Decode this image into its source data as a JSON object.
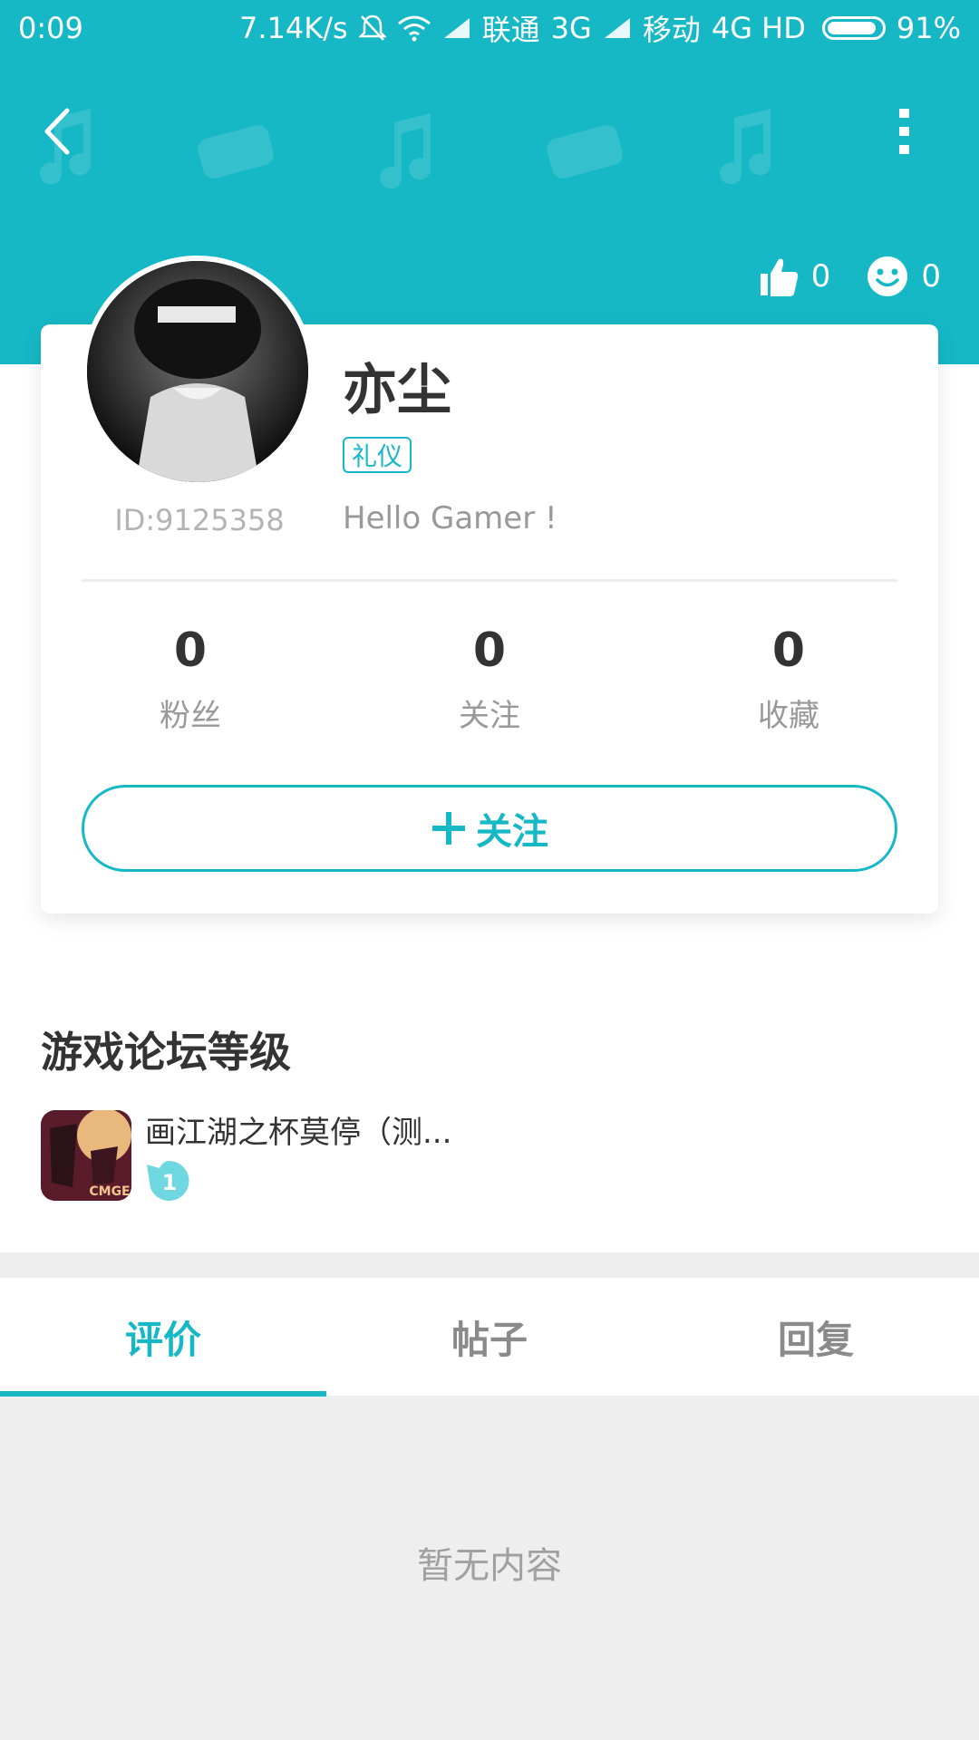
{
  "status_bar": {
    "time": "0:09",
    "net_speed": "7.14K/s",
    "carrier1": "联通",
    "net1": "3G",
    "carrier2": "移动",
    "net2": "4G HD",
    "battery": "91%",
    "battery_level": 0.91
  },
  "header": {
    "back_icon": "chevron-left-icon",
    "more_icon": "more-vertical-icon",
    "likes_count": "0",
    "smiles_count": "0"
  },
  "profile": {
    "username": "亦尘",
    "badge": "礼仪",
    "id_text": "ID:9125358",
    "bio": "Hello Gamer !",
    "stats": [
      {
        "value": "0",
        "label": "粉丝"
      },
      {
        "value": "0",
        "label": "关注"
      },
      {
        "value": "0",
        "label": "收藏"
      }
    ],
    "follow_label": "关注"
  },
  "forum_level": {
    "title": "游戏论坛等级",
    "game_name": "画江湖之杯莫停（测...",
    "icon_text": "CMGE",
    "level": "1"
  },
  "tabs": [
    {
      "label": "评价",
      "active": true
    },
    {
      "label": "帖子",
      "active": false
    },
    {
      "label": "回复",
      "active": false
    }
  ],
  "empty_state": "暂无内容",
  "colors": {
    "accent": "#16b8c6",
    "background": "#eeeeee"
  }
}
